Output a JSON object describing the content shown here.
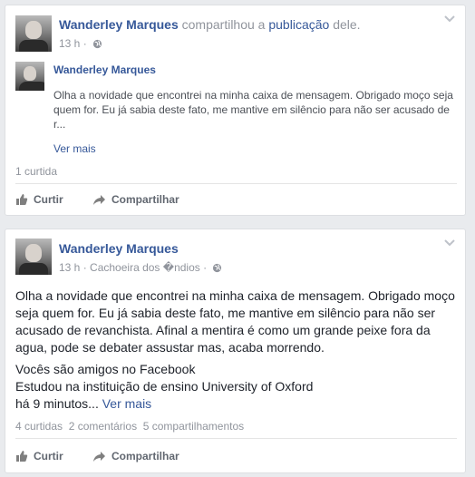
{
  "post1": {
    "author": "Wanderley Marques",
    "share_text": "compartilhou a",
    "share_link": "publicação",
    "share_suffix": "dele.",
    "time": "13 h",
    "time_sep": "·",
    "shared": {
      "author": "Wanderley Marques",
      "text": "Olha a novidade que encontrei na minha caixa de mensagem. Obrigado moço seja quem for. Eu já sabia deste fato, me mantive em silêncio para não ser acusado de r...",
      "see_more": "Ver mais"
    },
    "likes": "1 curtida",
    "like_label": "Curtir",
    "share_label": "Compartilhar"
  },
  "post2": {
    "author": "Wanderley Marques",
    "time": "13 h",
    "time_sep": "·",
    "location": "Cachoeira dos �ndios",
    "location_sep": "·",
    "text": "Olha a novidade que encontrei na minha caixa de mensagem. Obrigado moço seja quem for. Eu já sabia deste fato, me mantive em silêncio para não ser acusado de revanchista. Afinal a mentira é como um grande peixe fora da agua, pode se debater assustar mas, acaba morrendo.",
    "line1": "Vocês são amigos no Facebook",
    "line2": "Estudou na instituição de ensino University of Oxford",
    "line3": "há 9 minutos...",
    "see_more": "Ver mais",
    "likes": "4 curtidas",
    "comments": "2 comentários",
    "shares": "5 compartilhamentos",
    "like_label": "Curtir",
    "share_label": "Compartilhar"
  },
  "icons": {
    "chevron": "chevron-down-icon",
    "globe": "globe-icon",
    "like": "thumbs-up-icon",
    "share": "share-arrow-icon"
  },
  "colors": {
    "link": "#365899",
    "muted": "#90949c",
    "background": "#e9ebee"
  }
}
